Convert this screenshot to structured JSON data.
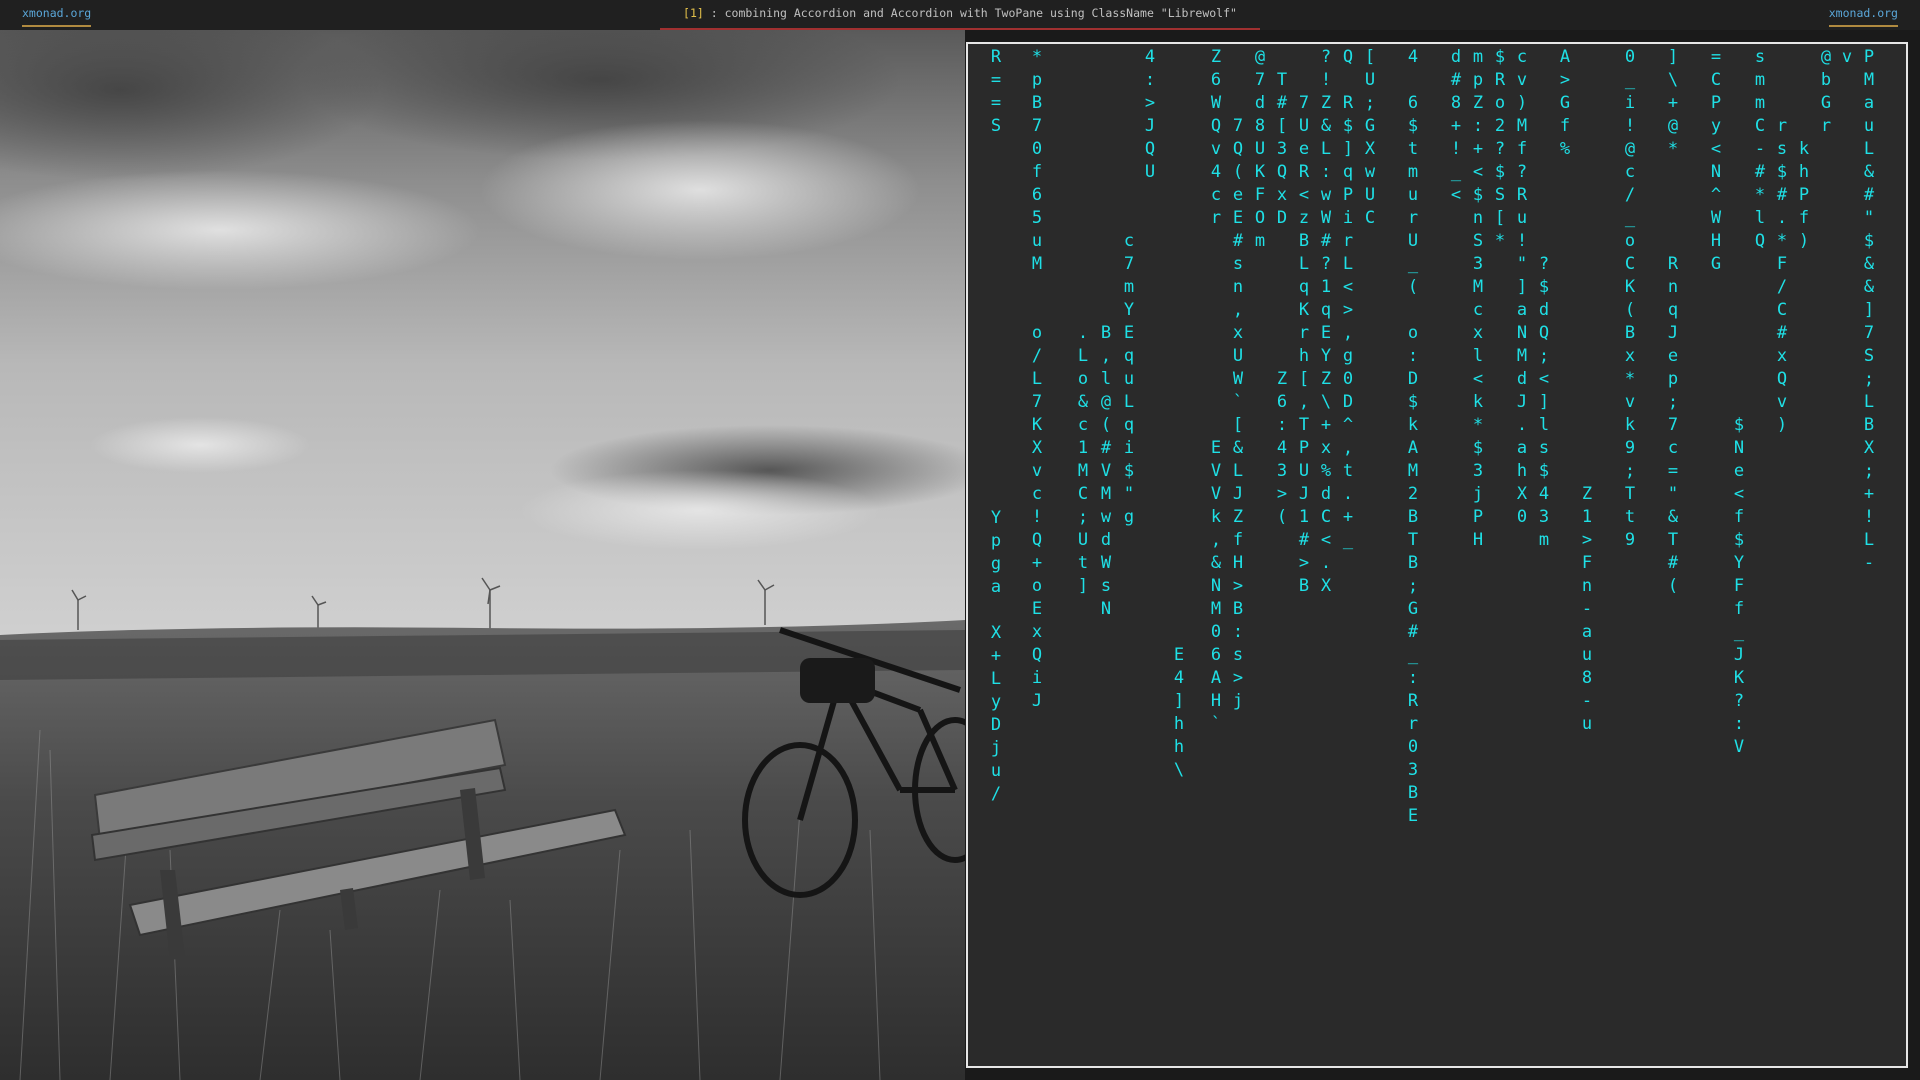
{
  "bar": {
    "left": "xmonad.org",
    "workspace": "[1]",
    "title": " : combining Accordion and Accordion with TwoPane using ClassName \"Librewolf\"",
    "right": "xmonad.org"
  },
  "colors": {
    "matrix": "#1fe0e6",
    "bar_bg": "#202020",
    "terminal_bg": "#2a2a2a"
  },
  "terminal": {
    "columns": [
      "R==S",
      "Ypga X+LyDju/",
      "*pB70f65uM",
      "o/L7KXvc!Q+oExQiJ",
      ".Lo&c1MC;Ut]",
      "B,l@(#VMwdWsN",
      "c7mYEquLqi$\"g",
      "4:>JQU",
      "E4]hh\\",
      "Z6WQv4cr",
      "EVVk,&NM06AH`",
      "7Q(eE#sn,xUW`[&LJZfH>B:s>j",
      "@7d8UKFOm",
      "T#[3QxD",
      "Z6:43>(",
      "7UeR<zBLqKrh[,TPUJ1#>B",
      "?!Z&L:wW#?1qEYZ\\+x%dC<.X",
      "Q R$]qPirL<>,g0D^,t.+_",
      "[U;GXwUC",
      "4 6$tmurU_(",
      "o:D$kAM2BTB;G#_:Rr03BE",
      "d#8+!_<",
      "mpZ:+<$nS3Mcxl<k*$3jPH",
      "$Ro2?$S[*",
      "cv)Mf?Ru!\"]aNMdJ.ahX0",
      "?$dQ;<]ls$43m",
      "A>Gf%",
      "Z1>Fn-au8-u",
      "0_i!@c/_oCK(Bx*vk9;Tt9",
      "]\\+@*",
      "RnqJep;7c=\"&T#(",
      "=CPy<N^WHG",
      "$Ne<f$YFf_JK?:V",
      "smmC-#*lQ",
      "rs$#.*F/C#xQv)",
      "khPf)",
      "@bGr",
      "v",
      "PMauL&#\"$&&]7S;LBX;+!L-"
    ]
  }
}
